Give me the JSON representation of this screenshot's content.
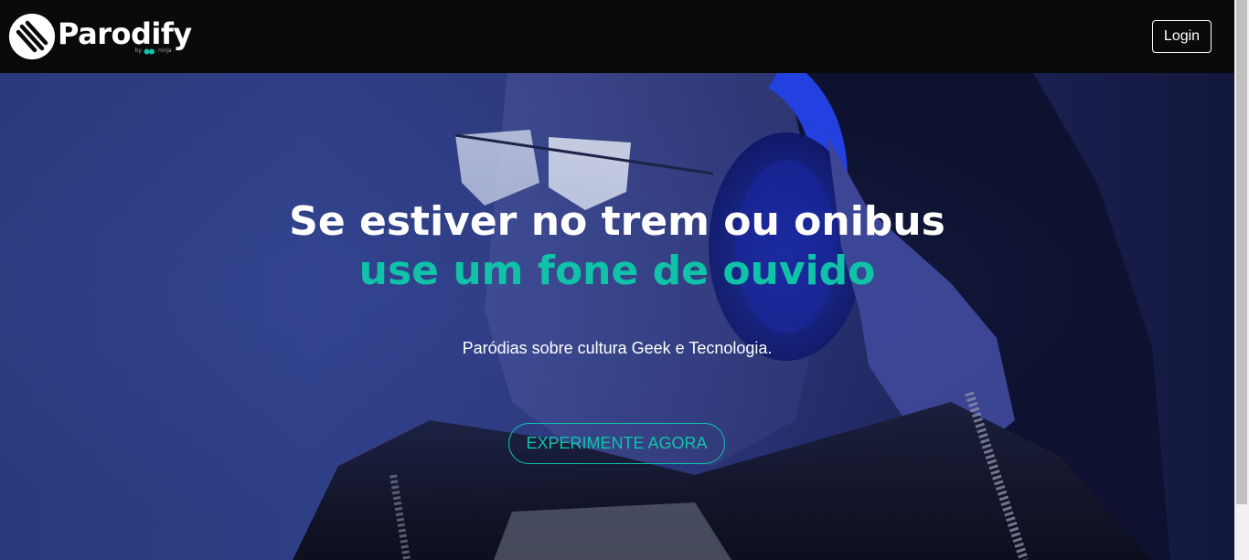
{
  "navbar": {
    "brand_name": "Parodify",
    "brand_by": "by",
    "brand_partner": "ninja",
    "login_label": "Login"
  },
  "hero": {
    "headline_line1": "Se estiver no trem ou onibus",
    "headline_line2": "use um fone de ouvido",
    "subtitle": "Paródias sobre cultura Geek e Tecnologia.",
    "cta_label": "EXPERIMENTE AGORA",
    "background_image": "woman-with-headphones-photo"
  },
  "colors": {
    "accent": "#10c2a8",
    "navbar_bg": "#0a0a0a",
    "hero_blue": "#2f3f86",
    "text": "#ffffff"
  },
  "icons": {
    "logo": "parodify-logo-icon"
  }
}
